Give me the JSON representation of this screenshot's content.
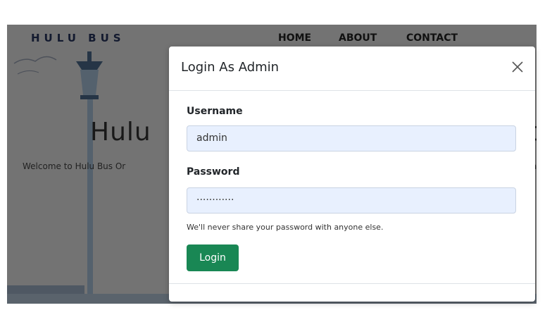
{
  "navbar": {
    "brand": "HULU BUS",
    "links": [
      "HOME",
      "ABOUT",
      "CONTACT"
    ]
  },
  "hero": {
    "title": "Hulu",
    "title_right_fragment": "c",
    "subtitle": "Welcome to Hulu Bus Or",
    "subtitle_right_fragment": "a"
  },
  "modal": {
    "title": "Login As Admin",
    "close_icon": "close-icon",
    "username_label": "Username",
    "username_value": "admin",
    "password_label": "Password",
    "password_value": "············",
    "help_text": "We'll never share your password with anyone else.",
    "login_button": "Login"
  },
  "colors": {
    "brand": "#27345e",
    "login_button": "#198754",
    "input_bg": "#e8f0fe",
    "backdrop": "rgba(0,0,0,0.5)"
  }
}
